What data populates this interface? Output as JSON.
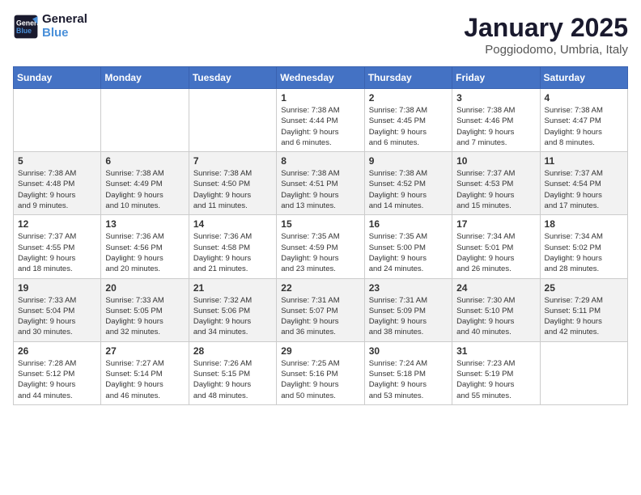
{
  "logo": {
    "line1": "General",
    "line2": "Blue"
  },
  "title": "January 2025",
  "location": "Poggiodomo, Umbria, Italy",
  "weekdays": [
    "Sunday",
    "Monday",
    "Tuesday",
    "Wednesday",
    "Thursday",
    "Friday",
    "Saturday"
  ],
  "weeks": [
    [
      {
        "day": "",
        "info": ""
      },
      {
        "day": "",
        "info": ""
      },
      {
        "day": "",
        "info": ""
      },
      {
        "day": "1",
        "info": "Sunrise: 7:38 AM\nSunset: 4:44 PM\nDaylight: 9 hours\nand 6 minutes."
      },
      {
        "day": "2",
        "info": "Sunrise: 7:38 AM\nSunset: 4:45 PM\nDaylight: 9 hours\nand 6 minutes."
      },
      {
        "day": "3",
        "info": "Sunrise: 7:38 AM\nSunset: 4:46 PM\nDaylight: 9 hours\nand 7 minutes."
      },
      {
        "day": "4",
        "info": "Sunrise: 7:38 AM\nSunset: 4:47 PM\nDaylight: 9 hours\nand 8 minutes."
      }
    ],
    [
      {
        "day": "5",
        "info": "Sunrise: 7:38 AM\nSunset: 4:48 PM\nDaylight: 9 hours\nand 9 minutes."
      },
      {
        "day": "6",
        "info": "Sunrise: 7:38 AM\nSunset: 4:49 PM\nDaylight: 9 hours\nand 10 minutes."
      },
      {
        "day": "7",
        "info": "Sunrise: 7:38 AM\nSunset: 4:50 PM\nDaylight: 9 hours\nand 11 minutes."
      },
      {
        "day": "8",
        "info": "Sunrise: 7:38 AM\nSunset: 4:51 PM\nDaylight: 9 hours\nand 13 minutes."
      },
      {
        "day": "9",
        "info": "Sunrise: 7:38 AM\nSunset: 4:52 PM\nDaylight: 9 hours\nand 14 minutes."
      },
      {
        "day": "10",
        "info": "Sunrise: 7:37 AM\nSunset: 4:53 PM\nDaylight: 9 hours\nand 15 minutes."
      },
      {
        "day": "11",
        "info": "Sunrise: 7:37 AM\nSunset: 4:54 PM\nDaylight: 9 hours\nand 17 minutes."
      }
    ],
    [
      {
        "day": "12",
        "info": "Sunrise: 7:37 AM\nSunset: 4:55 PM\nDaylight: 9 hours\nand 18 minutes."
      },
      {
        "day": "13",
        "info": "Sunrise: 7:36 AM\nSunset: 4:56 PM\nDaylight: 9 hours\nand 20 minutes."
      },
      {
        "day": "14",
        "info": "Sunrise: 7:36 AM\nSunset: 4:58 PM\nDaylight: 9 hours\nand 21 minutes."
      },
      {
        "day": "15",
        "info": "Sunrise: 7:35 AM\nSunset: 4:59 PM\nDaylight: 9 hours\nand 23 minutes."
      },
      {
        "day": "16",
        "info": "Sunrise: 7:35 AM\nSunset: 5:00 PM\nDaylight: 9 hours\nand 24 minutes."
      },
      {
        "day": "17",
        "info": "Sunrise: 7:34 AM\nSunset: 5:01 PM\nDaylight: 9 hours\nand 26 minutes."
      },
      {
        "day": "18",
        "info": "Sunrise: 7:34 AM\nSunset: 5:02 PM\nDaylight: 9 hours\nand 28 minutes."
      }
    ],
    [
      {
        "day": "19",
        "info": "Sunrise: 7:33 AM\nSunset: 5:04 PM\nDaylight: 9 hours\nand 30 minutes."
      },
      {
        "day": "20",
        "info": "Sunrise: 7:33 AM\nSunset: 5:05 PM\nDaylight: 9 hours\nand 32 minutes."
      },
      {
        "day": "21",
        "info": "Sunrise: 7:32 AM\nSunset: 5:06 PM\nDaylight: 9 hours\nand 34 minutes."
      },
      {
        "day": "22",
        "info": "Sunrise: 7:31 AM\nSunset: 5:07 PM\nDaylight: 9 hours\nand 36 minutes."
      },
      {
        "day": "23",
        "info": "Sunrise: 7:31 AM\nSunset: 5:09 PM\nDaylight: 9 hours\nand 38 minutes."
      },
      {
        "day": "24",
        "info": "Sunrise: 7:30 AM\nSunset: 5:10 PM\nDaylight: 9 hours\nand 40 minutes."
      },
      {
        "day": "25",
        "info": "Sunrise: 7:29 AM\nSunset: 5:11 PM\nDaylight: 9 hours\nand 42 minutes."
      }
    ],
    [
      {
        "day": "26",
        "info": "Sunrise: 7:28 AM\nSunset: 5:12 PM\nDaylight: 9 hours\nand 44 minutes."
      },
      {
        "day": "27",
        "info": "Sunrise: 7:27 AM\nSunset: 5:14 PM\nDaylight: 9 hours\nand 46 minutes."
      },
      {
        "day": "28",
        "info": "Sunrise: 7:26 AM\nSunset: 5:15 PM\nDaylight: 9 hours\nand 48 minutes."
      },
      {
        "day": "29",
        "info": "Sunrise: 7:25 AM\nSunset: 5:16 PM\nDaylight: 9 hours\nand 50 minutes."
      },
      {
        "day": "30",
        "info": "Sunrise: 7:24 AM\nSunset: 5:18 PM\nDaylight: 9 hours\nand 53 minutes."
      },
      {
        "day": "31",
        "info": "Sunrise: 7:23 AM\nSunset: 5:19 PM\nDaylight: 9 hours\nand 55 minutes."
      },
      {
        "day": "",
        "info": ""
      }
    ]
  ]
}
